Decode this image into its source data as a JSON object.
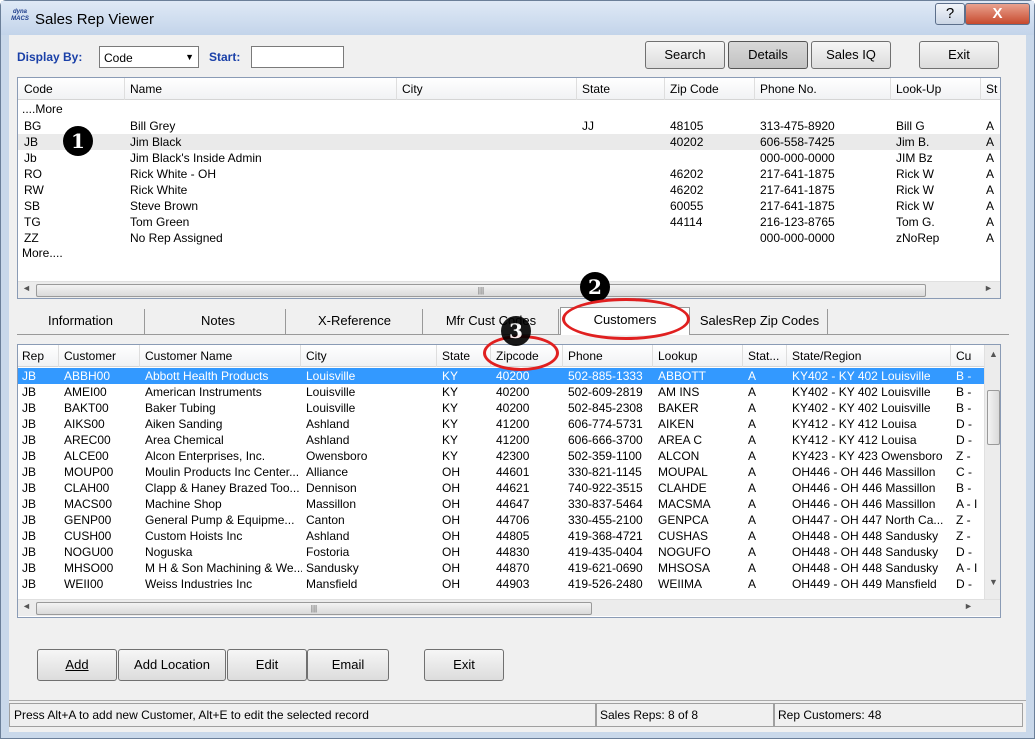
{
  "window": {
    "title": "Sales Rep Viewer",
    "logo": "dyna MACS",
    "help_label": "?",
    "close_label": "X"
  },
  "toolbar": {
    "display_by_label": "Display By:",
    "display_by_value": "Code",
    "start_label": "Start:",
    "start_value": "",
    "search": "Search",
    "details": "Details",
    "sales_iq": "Sales IQ",
    "exit": "Exit"
  },
  "reps": {
    "columns": [
      "Code",
      "Name",
      "City",
      "State",
      "Zip Code",
      "Phone No.",
      "Look-Up",
      "St"
    ],
    "more_top": "....More",
    "more_bottom": "More....",
    "rows": [
      [
        "BG",
        "Bill Grey",
        "",
        "JJ",
        "48105",
        "313-475-8920",
        "Bill G",
        "A"
      ],
      [
        "JB",
        "Jim Black",
        "",
        "",
        "40202",
        "606-558-7425",
        "Jim B.",
        "A"
      ],
      [
        "Jb",
        "Jim Black's Inside Admin",
        "",
        "",
        "",
        "000-000-0000",
        "JIM Bz",
        "A"
      ],
      [
        "RO",
        "Rick White - OH",
        "",
        "",
        "46202",
        "217-641-1875",
        "Rick W",
        "A"
      ],
      [
        "RW",
        "Rick White",
        "",
        "",
        "46202",
        "217-641-1875",
        "Rick W",
        "A"
      ],
      [
        "SB",
        "Steve Brown",
        "",
        "",
        "60055",
        "217-641-1875",
        "Rick W",
        "A"
      ],
      [
        "TG",
        "Tom Green",
        "",
        "",
        "44114",
        "216-123-8765",
        "Tom G.",
        "A"
      ],
      [
        "ZZ",
        "No Rep Assigned",
        "",
        "",
        "",
        "000-000-0000",
        "zNoRep",
        "A"
      ]
    ]
  },
  "tabs": [
    "Information",
    "Notes",
    "X-Reference",
    "Mfr Cust Codes",
    "Customers",
    "SalesRep Zip Codes"
  ],
  "customers": {
    "columns": [
      "Rep",
      "Customer",
      "Customer Name",
      "City",
      "State",
      "Zipcode",
      "Phone",
      "Lookup",
      "Stat...",
      "State/Region",
      "Cu"
    ],
    "rows": [
      [
        "JB",
        "ABBH00",
        "Abbott Health Products",
        "Louisville",
        "KY",
        "40200",
        "502-885-1333",
        "ABBOTT",
        "A",
        "KY402 - KY 402 Louisville",
        "B -"
      ],
      [
        "JB",
        "AMEI00",
        "American Instruments",
        "Louisville",
        "KY",
        "40200",
        "502-609-2819",
        "AM INS",
        "A",
        "KY402 - KY 402 Louisville",
        "B -"
      ],
      [
        "JB",
        "BAKT00",
        "Baker Tubing",
        "Louisville",
        "KY",
        "40200",
        "502-845-2308",
        "BAKER",
        "A",
        "KY402 - KY 402 Louisville",
        "B -"
      ],
      [
        "JB",
        "AIKS00",
        "Aiken Sanding",
        "Ashland",
        "KY",
        "41200",
        "606-774-5731",
        "AIKEN",
        "A",
        "KY412 - KY 412 Louisa",
        "D -"
      ],
      [
        "JB",
        "AREC00",
        "Area Chemical",
        "Ashland",
        "KY",
        "41200",
        "606-666-3700",
        "AREA C",
        "A",
        "KY412 - KY 412 Louisa",
        "D -"
      ],
      [
        "JB",
        "ALCE00",
        "Alcon Enterprises, Inc.",
        "Owensboro",
        "KY",
        "42300",
        "502-359-1100",
        "ALCON",
        "A",
        "KY423 - KY 423 Owensboro",
        "Z -"
      ],
      [
        "JB",
        "MOUP00",
        "Moulin Products Inc Center...",
        "Alliance",
        "OH",
        "44601",
        "330-821-1145",
        "MOUPAL",
        "A",
        "OH446 - OH 446 Massillon",
        "C -"
      ],
      [
        "JB",
        "CLAH00",
        "Clapp & Haney Brazed Too...",
        "Dennison",
        "OH",
        "44621",
        "740-922-3515",
        "CLAHDE",
        "A",
        "OH446 - OH 446 Massillon",
        "B -"
      ],
      [
        "JB",
        "MACS00",
        "Machine Shop",
        "Massillon",
        "OH",
        "44647",
        "330-837-5464",
        "MACSMA",
        "A",
        "OH446 - OH 446 Massillon",
        "A - I"
      ],
      [
        "JB",
        "GENP00",
        "General Pump & Equipme...",
        "Canton",
        "OH",
        "44706",
        "330-455-2100",
        "GENPCA",
        "A",
        "OH447 - OH 447 North Ca...",
        "Z -"
      ],
      [
        "JB",
        "CUSH00",
        "Custom Hoists Inc",
        "Ashland",
        "OH",
        "44805",
        "419-368-4721",
        "CUSHAS",
        "A",
        "OH448 - OH 448 Sandusky",
        "Z -"
      ],
      [
        "JB",
        "NOGU00",
        "Noguska",
        "Fostoria",
        "OH",
        "44830",
        "419-435-0404",
        "NOGUFO",
        "A",
        "OH448 - OH 448 Sandusky",
        "D -"
      ],
      [
        "JB",
        "MHSO00",
        "M H & Son Machining & We...",
        "Sandusky",
        "OH",
        "44870",
        "419-621-0690",
        "MHSOSA",
        "A",
        "OH448 - OH 448 Sandusky",
        "A - I"
      ],
      [
        "JB",
        "WEII00",
        "Weiss Industries Inc",
        "Mansfield",
        "OH",
        "44903",
        "419-526-2480",
        "WEIIMA",
        "A",
        "OH449 - OH 449 Mansfield",
        "D -"
      ]
    ]
  },
  "bottom": {
    "add": "Add",
    "add_location": "Add Location",
    "edit": "Edit",
    "email": "Email",
    "exit": "Exit"
  },
  "status": {
    "hint": "Press Alt+A to add new Customer,  Alt+E to edit the selected record",
    "reps": "Sales Reps: 8 of 8",
    "customers": "Rep Customers: 48"
  },
  "callouts": [
    "1",
    "2",
    "3"
  ],
  "icons": {
    "scroll_left": "◄",
    "scroll_right": "►",
    "scroll_up": "▲",
    "scroll_down": "▼",
    "grip": "|||",
    "dropdown": "▼"
  }
}
